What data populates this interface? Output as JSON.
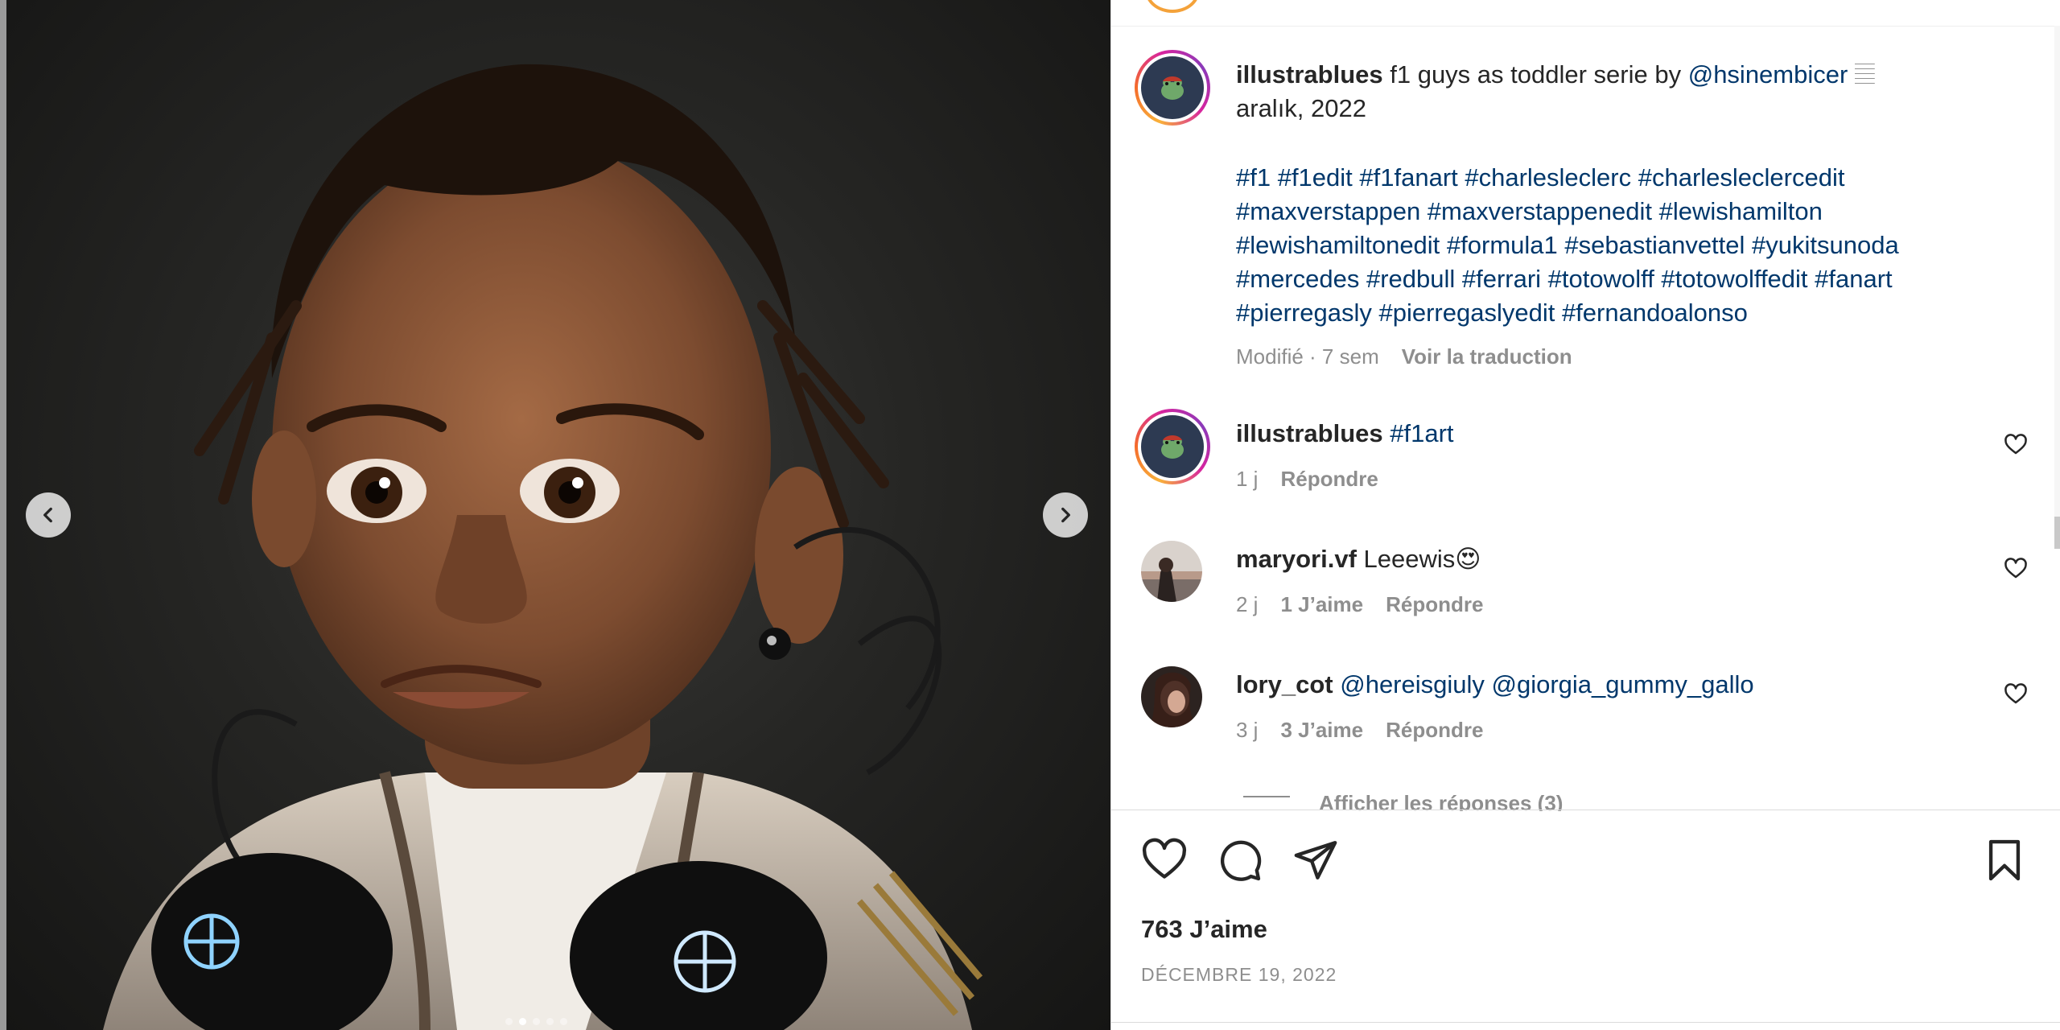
{
  "post": {
    "author": "illustrablues",
    "caption_text": "f1 guys as toddler serie by",
    "caption_mention": "@hsinembicer",
    "caption_emoji": "𝄚",
    "caption_line2": "aralık, 2022",
    "hashtags_lines": [
      "#f1 #f1edit #f1fanart #charlesleclerc #charlesleclercedit",
      "#maxverstappen #maxverstappenedit #lewishamilton",
      "#lewishamiltonedit #formula1 #sebastianvettel #yukitsunoda",
      "#mercedes #redbull #ferrari #totowolff #totowolffedit #fanart",
      "#pierregasly #pierregaslyedit #fernandoalonso"
    ],
    "edited_meta": "Modifié · 7 sem",
    "translate_label": "Voir la traduction"
  },
  "comments": [
    {
      "user": "illustrablues",
      "text": "#f1art",
      "time": "1 j",
      "likes": "",
      "reply": "Répondre"
    },
    {
      "user": "maryori.vf",
      "text": "Leeewis😍",
      "time": "2 j",
      "likes": "1 J’aime",
      "reply": "Répondre"
    },
    {
      "user": "lory_cot",
      "text": "@hereisgiuly @giorgia_gummy_gallo",
      "time": "3 j",
      "likes": "3 J’aime",
      "reply": "Répondre"
    }
  ],
  "view_replies": "Afficher les réponses (3)",
  "likes_count": "763 J’aime",
  "post_date": "DÉCEMBRE 19, 2022",
  "icons": {
    "prev": "chevron-left-icon",
    "next": "chevron-right-icon",
    "like": "heart-icon",
    "comment": "comment-icon",
    "share": "paper-plane-icon",
    "save": "bookmark-icon"
  },
  "colors": {
    "link": "#00376b",
    "muted": "#8e8e8e",
    "text": "#262626"
  }
}
